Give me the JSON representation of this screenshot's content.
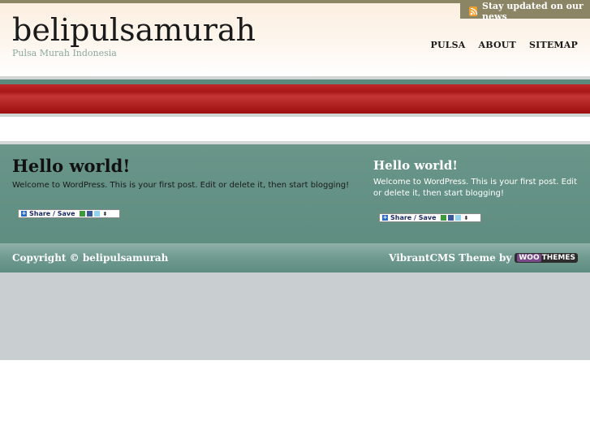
{
  "header": {
    "site_title": "belipulsamurah",
    "tagline": "Pulsa Murah Indonesia",
    "rss_label": "Stay updated on our news",
    "nav": [
      "PULSA",
      "ABOUT",
      "SITEMAP"
    ]
  },
  "posts": {
    "left": {
      "title": "Hello world!",
      "text": "Welcome to WordPress. This is your first post. Edit or delete it, then start blogging!",
      "share_label": "Share / Save"
    },
    "right": {
      "title": "Hello world!",
      "text": "Welcome to WordPress. This is your first post. Edit or delete it, then start blogging!",
      "share_label": "Share / Save"
    }
  },
  "footer": {
    "copyright": "Copyright © belipulsamurah",
    "credit": "VibrantCMS Theme by",
    "woo_logo_a": "WOO",
    "woo_logo_b": "THEMES"
  },
  "colors": {
    "accent": "#8c8565",
    "band_red": "#a81818",
    "content_green": "#5f8d80"
  },
  "icons": {
    "rss": "rss-icon",
    "share_plus": "plus-icon",
    "share_arrows": "up-down-icon"
  }
}
